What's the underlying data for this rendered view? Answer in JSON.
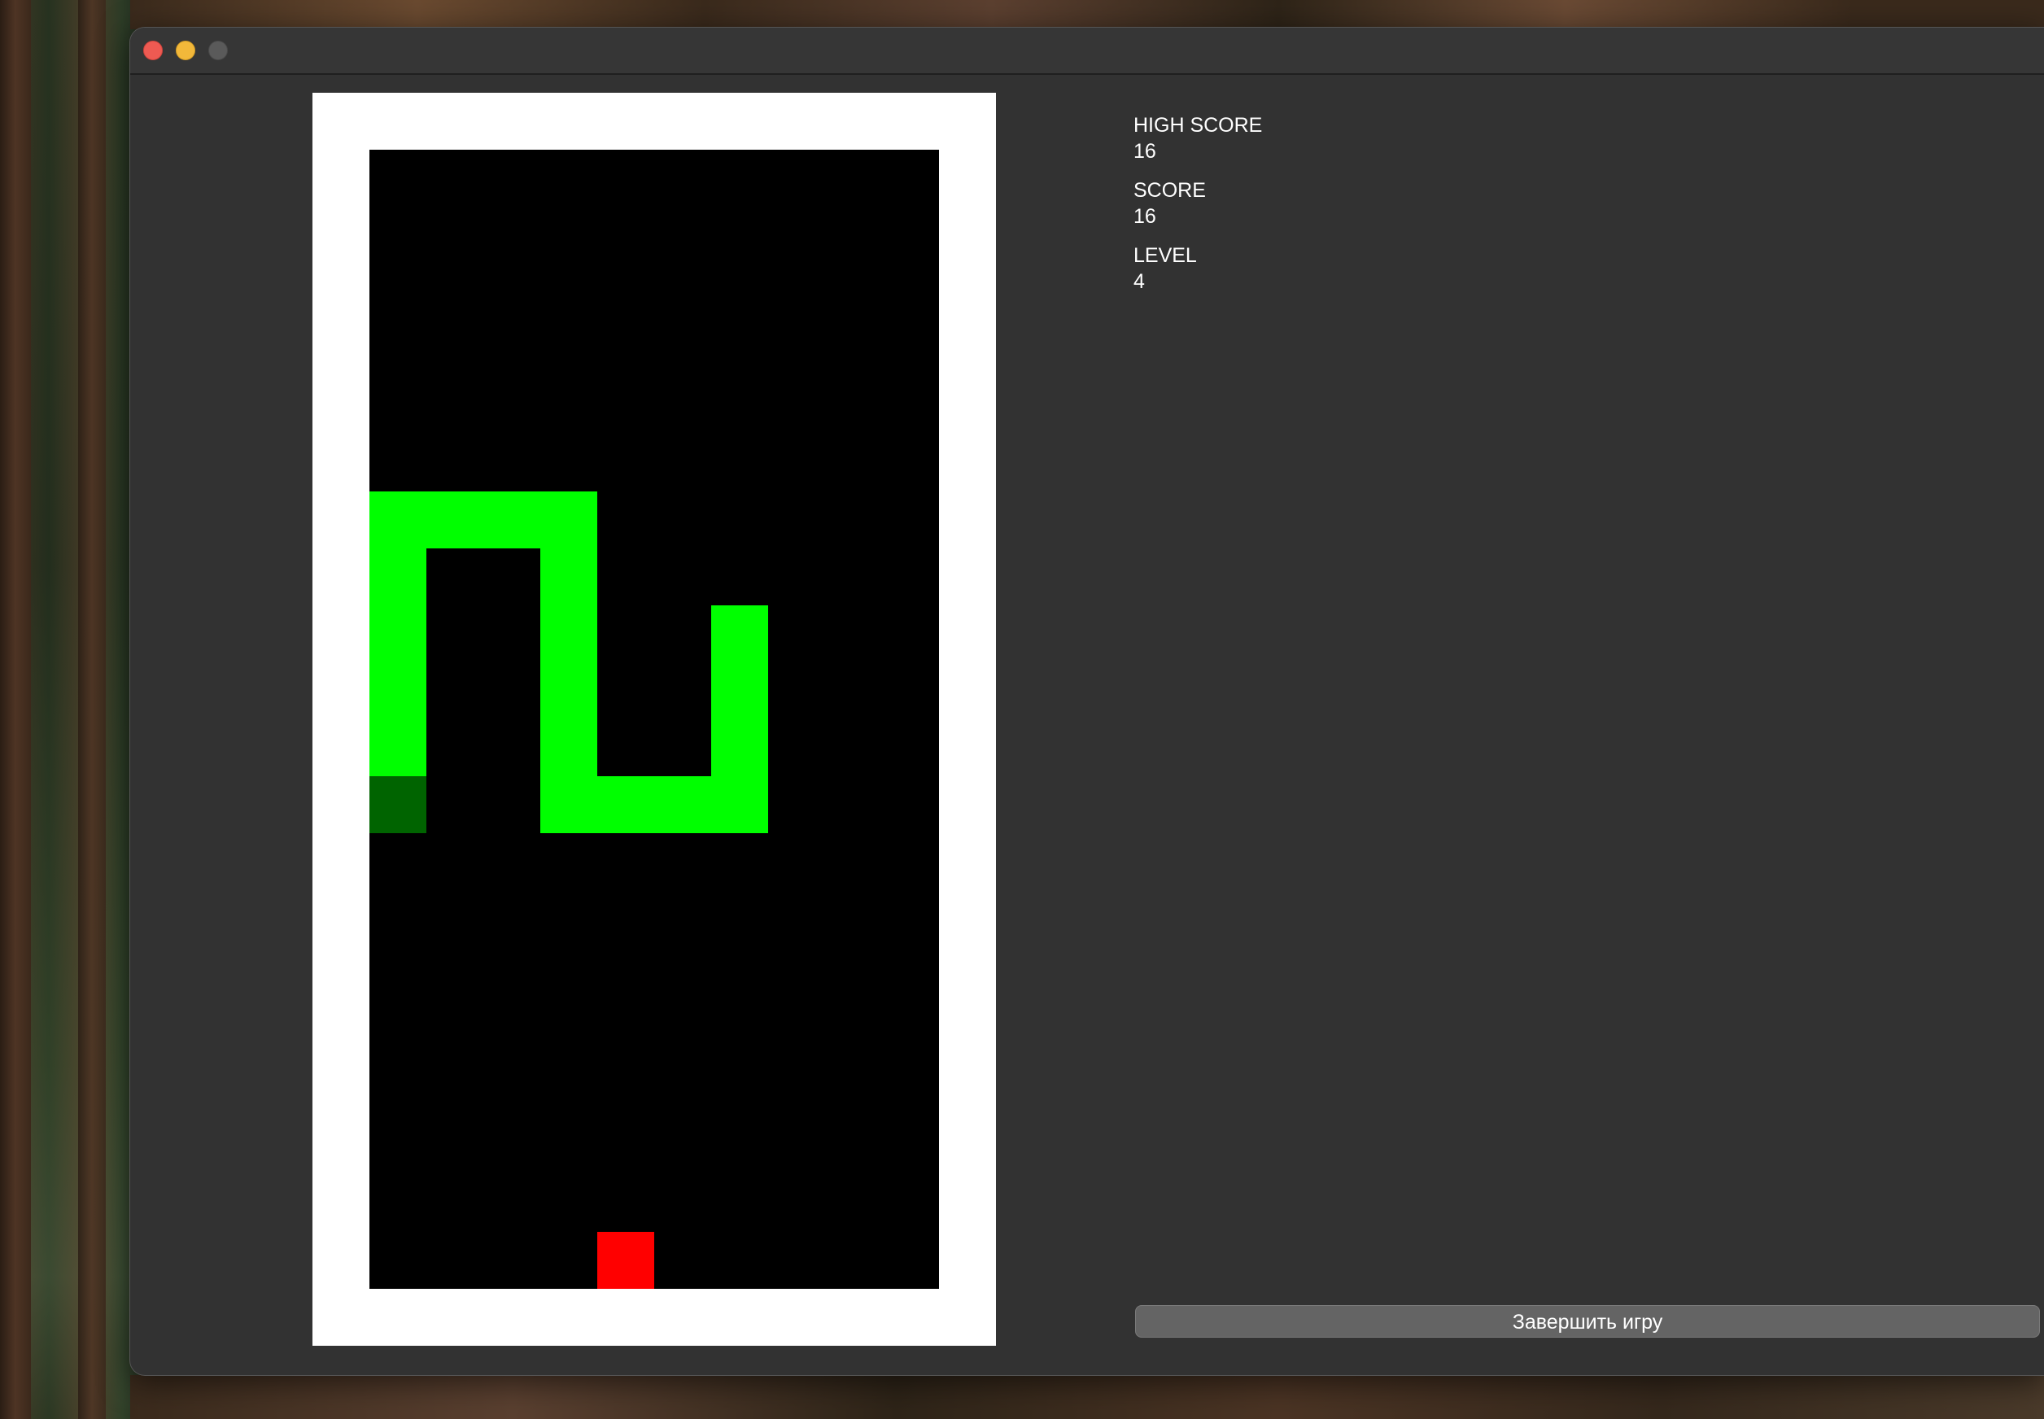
{
  "window": {
    "controls": [
      "close-button",
      "minimize-button",
      "maximize-button"
    ]
  },
  "stats": {
    "high_score_label": "HIGH SCORE",
    "high_score": "16",
    "score_label": "SCORE",
    "score": "16",
    "level_label": "LEVEL",
    "level": "4"
  },
  "actions": {
    "end_game_label": "Завершить игру"
  },
  "game": {
    "grid": {
      "cols": 10,
      "rows": 20
    },
    "colors": {
      "board": "#000000",
      "frame": "#ffffff",
      "snake_body": "#00ff00",
      "snake_tail": "#006400",
      "food": "#ff0000",
      "window_bg": "#323232",
      "button_bg": "#646464"
    },
    "snake": [
      [
        0,
        11
      ],
      [
        0,
        10
      ],
      [
        0,
        9
      ],
      [
        0,
        8
      ],
      [
        0,
        7
      ],
      [
        0,
        6
      ],
      [
        1,
        6
      ],
      [
        2,
        6
      ],
      [
        3,
        6
      ],
      [
        3,
        7
      ],
      [
        3,
        8
      ],
      [
        3,
        9
      ],
      [
        3,
        10
      ],
      [
        3,
        11
      ],
      [
        4,
        11
      ],
      [
        5,
        11
      ],
      [
        6,
        11
      ],
      [
        6,
        10
      ],
      [
        6,
        9
      ],
      [
        6,
        8
      ]
    ],
    "snake_tail_index": 0,
    "food": [
      4,
      19
    ]
  }
}
